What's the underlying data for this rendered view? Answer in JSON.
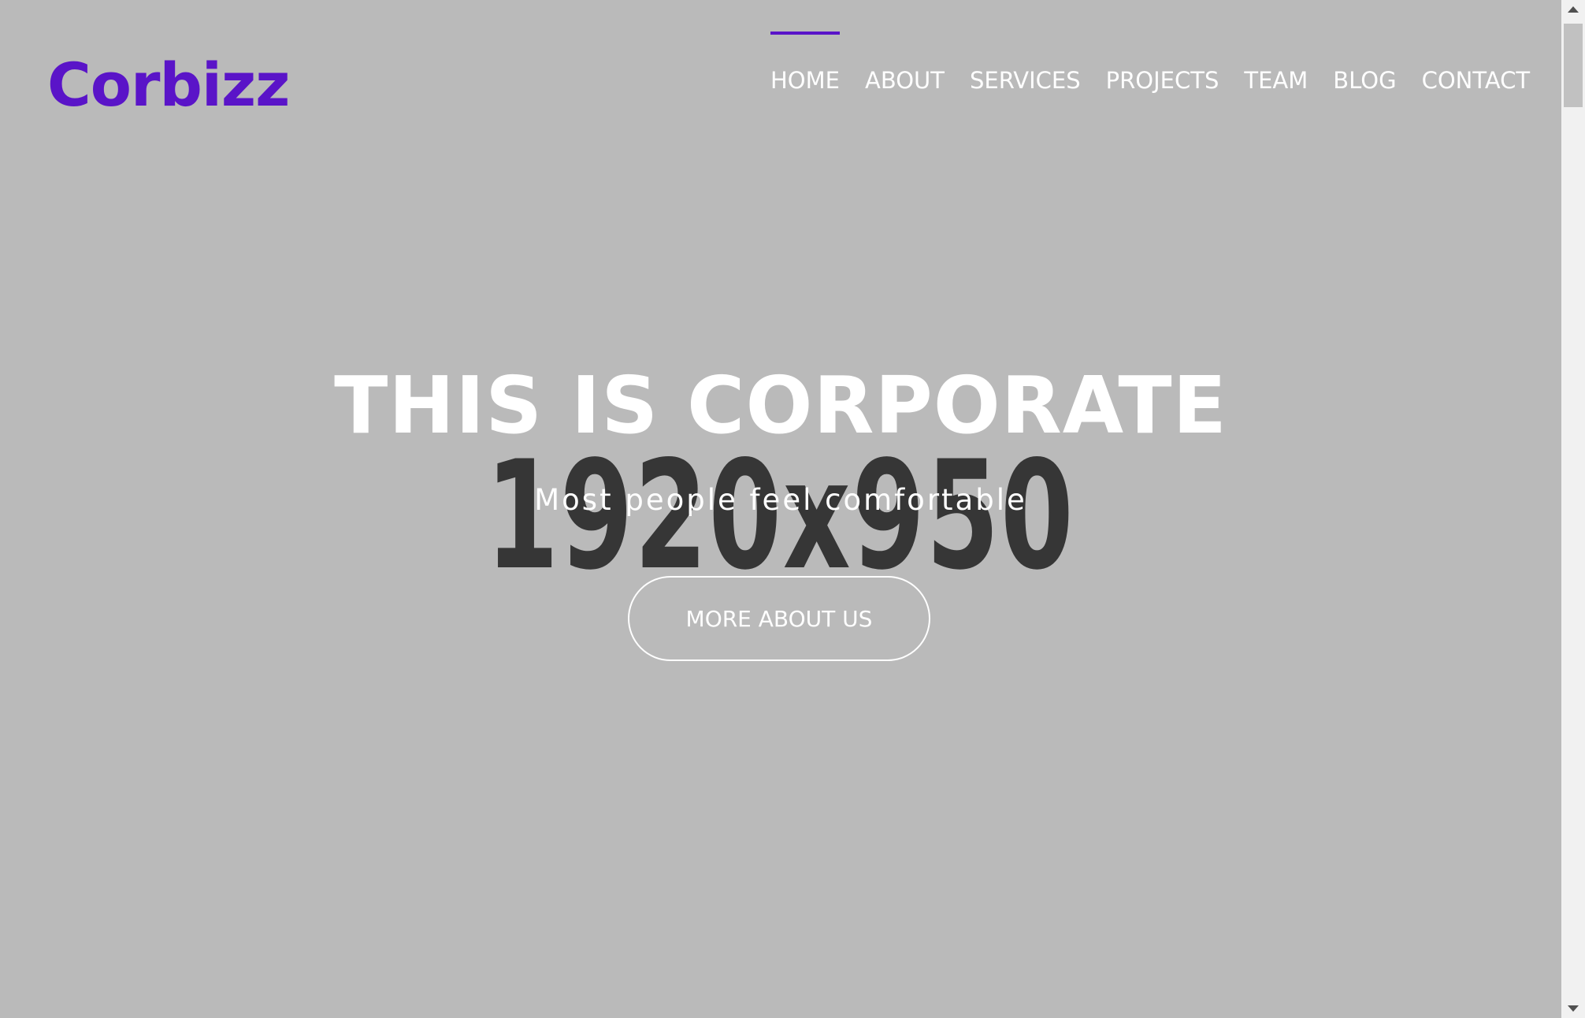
{
  "brand": {
    "logo_text": "Corbizz",
    "accent_color": "#5a14c8"
  },
  "nav": {
    "items": [
      {
        "label": "HOME",
        "active": true
      },
      {
        "label": "ABOUT",
        "active": false
      },
      {
        "label": "SERVICES",
        "active": false
      },
      {
        "label": "PROJECTS",
        "active": false
      },
      {
        "label": "TEAM",
        "active": false
      },
      {
        "label": "BLOG",
        "active": false
      },
      {
        "label": "CONTACT",
        "active": false
      }
    ]
  },
  "hero": {
    "background_placeholder": "1920x950",
    "title": "THIS IS CORPORATE",
    "subtitle": "Most people feel comfortable",
    "cta_label": "MORE ABOUT US",
    "background_color": "#bababa"
  },
  "scrollbar": {
    "up_icon": "triangle-up",
    "down_icon": "triangle-down"
  }
}
